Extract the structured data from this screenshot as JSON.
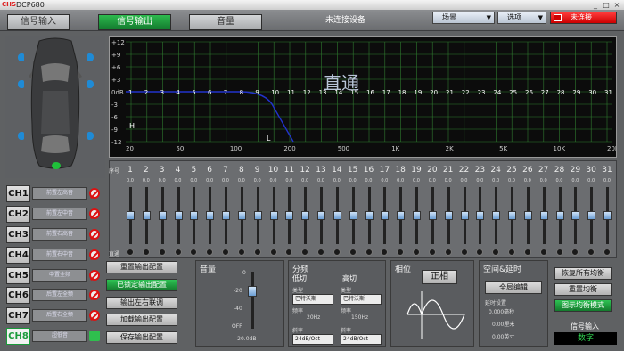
{
  "window": {
    "logo": "CHS",
    "title": "DCP680",
    "min": "_",
    "max": "□",
    "close": "×"
  },
  "tabs": {
    "input": "信号输入",
    "output": "信号输出",
    "volume": "音量"
  },
  "status": "未连接设备",
  "menus": {
    "scene": "场景",
    "options": "选项",
    "connect": "未连接"
  },
  "channels": [
    {
      "label": "CH1",
      "name": "前置左高音"
    },
    {
      "label": "CH2",
      "name": "前置左中音"
    },
    {
      "label": "CH3",
      "name": "前置右高音"
    },
    {
      "label": "CH4",
      "name": "前置右中音"
    },
    {
      "label": "CH5",
      "name": "中置全频"
    },
    {
      "label": "CH6",
      "name": "后置左全频"
    },
    {
      "label": "CH7",
      "name": "后置右全频"
    },
    {
      "label": "CH8",
      "name": "超低音"
    }
  ],
  "graph": {
    "mode_label": "直通",
    "y_labels": [
      "+12",
      "+9",
      "+6",
      "+3",
      "0dB",
      "-3",
      "-6",
      "-9",
      "-12"
    ],
    "x_labels": [
      "20",
      "50",
      "100",
      "200",
      "500",
      "1K",
      "2K",
      "5K",
      "10K",
      "20K"
    ],
    "h_marker": "H",
    "l_marker": "L",
    "band_labels": [
      "1",
      "2",
      "3",
      "4",
      "5",
      "6",
      "7",
      "8",
      "9",
      "10",
      "11",
      "12",
      "13",
      "14",
      "15",
      "16",
      "17",
      "18",
      "19",
      "20",
      "21",
      "22",
      "23",
      "24",
      "25",
      "26",
      "27",
      "28",
      "29",
      "30",
      "31"
    ]
  },
  "eq": {
    "seq_label": "序号",
    "direct_label": "直通",
    "bands": [
      "1",
      "2",
      "3",
      "4",
      "5",
      "6",
      "7",
      "8",
      "9",
      "10",
      "11",
      "12",
      "13",
      "14",
      "15",
      "16",
      "17",
      "18",
      "19",
      "20",
      "21",
      "22",
      "23",
      "24",
      "25",
      "26",
      "27",
      "28",
      "29",
      "30",
      "31"
    ],
    "band_value": "0.0"
  },
  "output_buttons": [
    "重置输出配置",
    "已锁定输出配置",
    "输出左右联调",
    "加载输出配置",
    "保存输出配置"
  ],
  "volume": {
    "title": "音量",
    "ticks": [
      "0",
      "-20",
      "-40",
      "OFF"
    ],
    "value": "-20.0dB"
  },
  "crossover": {
    "title": "分频",
    "low_title": "低切",
    "high_title": "高切",
    "type_label": "类型",
    "freq_label": "频率",
    "slope_label": "斜率",
    "low_type": "巴特沃斯",
    "high_type": "巴特沃斯",
    "low_freq": "20Hz",
    "high_freq": "150Hz",
    "low_slope": "24dB/Oct",
    "high_slope": "24dB/Oct"
  },
  "phase": {
    "title": "相位",
    "button": "正相"
  },
  "delay": {
    "title": "空间&延时",
    "button": "全局编辑",
    "setting_label": "延时设置",
    "ms": "0.000毫秒",
    "cm": "0.00厘米",
    "inch": "0.00英寸"
  },
  "right_buttons": [
    "恢复所有均衡",
    "重置均衡",
    "图示均衡模式"
  ],
  "signal": {
    "label": "信号输入",
    "value": "数字"
  },
  "colors": {
    "accent_green": "#1f9a3f",
    "curve_blue": "#2233cc",
    "grid_green": "#2f7a2f"
  }
}
